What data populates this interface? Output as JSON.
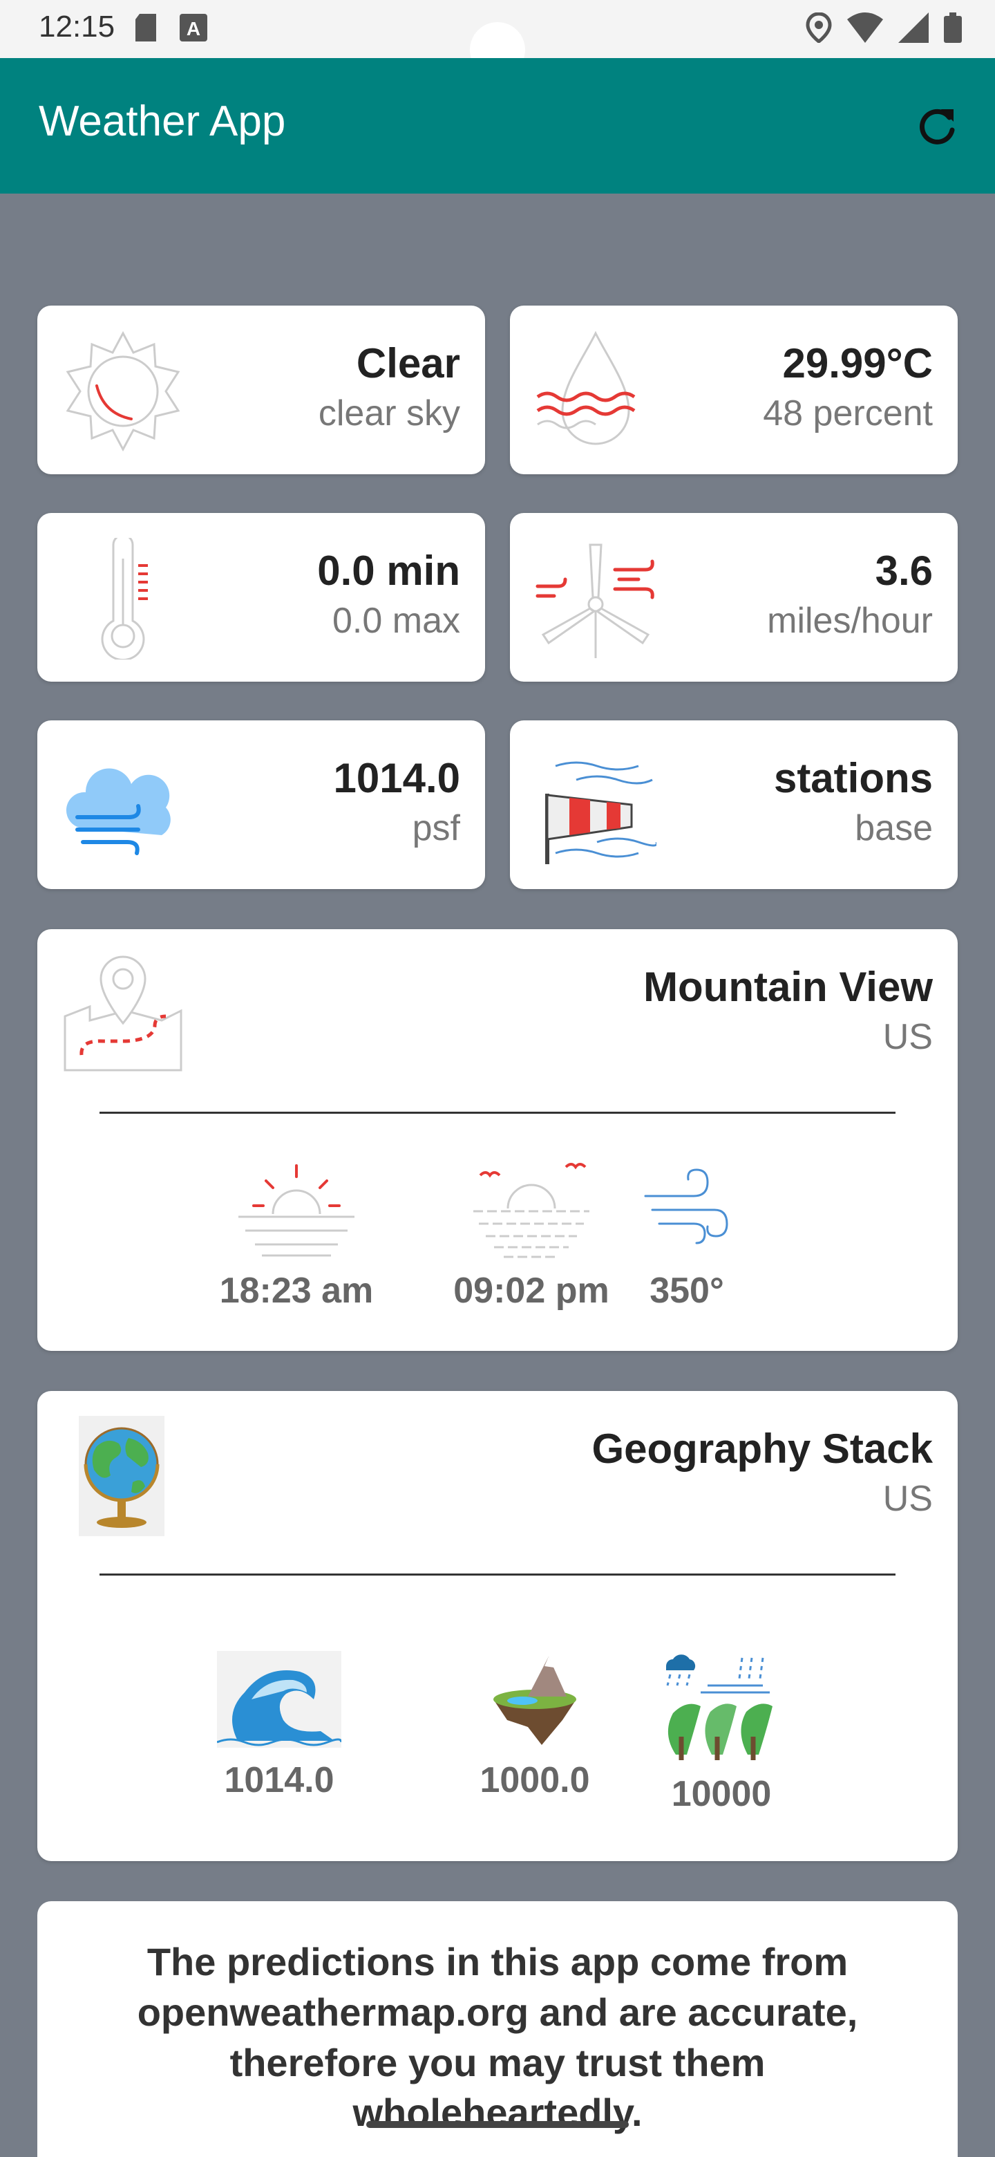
{
  "status_bar": {
    "time": "12:15"
  },
  "app_bar": {
    "title": "Weather App"
  },
  "cards": {
    "condition": {
      "main": "Clear",
      "sub": "clear sky"
    },
    "humidity": {
      "main": "29.99°C",
      "sub": "48 percent"
    },
    "temperature": {
      "main": "0.0 min",
      "sub": "0.0 max"
    },
    "wind": {
      "main": "3.6",
      "sub": "miles/hour"
    },
    "pressure": {
      "main": "1014.0",
      "sub": "psf"
    },
    "stations": {
      "main": "stations",
      "sub": "base"
    }
  },
  "location": {
    "name": "Mountain View",
    "country": "US",
    "sunrise": "18:23 am",
    "sunset": "09:02 pm",
    "wind_direction": "350°"
  },
  "geography": {
    "title": "Geography Stack",
    "country": "US",
    "sea_level": "1014.0",
    "ground_level": "1000.0",
    "visibility": "10000"
  },
  "footer": {
    "text": "The predictions in this app come from openweathermap.org and are accurate, therefore you may trust them wholeheartedly."
  },
  "colors": {
    "app_bar": "#00827f",
    "background": "#767d88",
    "accent_red": "#e53935",
    "accent_blue": "#42a5f5"
  },
  "icons": [
    "sd-card-icon",
    "font-icon",
    "location-icon",
    "wifi-icon",
    "signal-icon",
    "battery-icon",
    "refresh-icon",
    "sun-icon",
    "humidity-drop-icon",
    "thermometer-icon",
    "wind-turbine-icon",
    "cloud-wind-icon",
    "windsock-icon",
    "map-pin-icon",
    "sunrise-icon",
    "sunset-icon",
    "wind-direction-icon",
    "globe-icon",
    "wave-icon",
    "floating-island-icon",
    "trees-rain-icon"
  ]
}
